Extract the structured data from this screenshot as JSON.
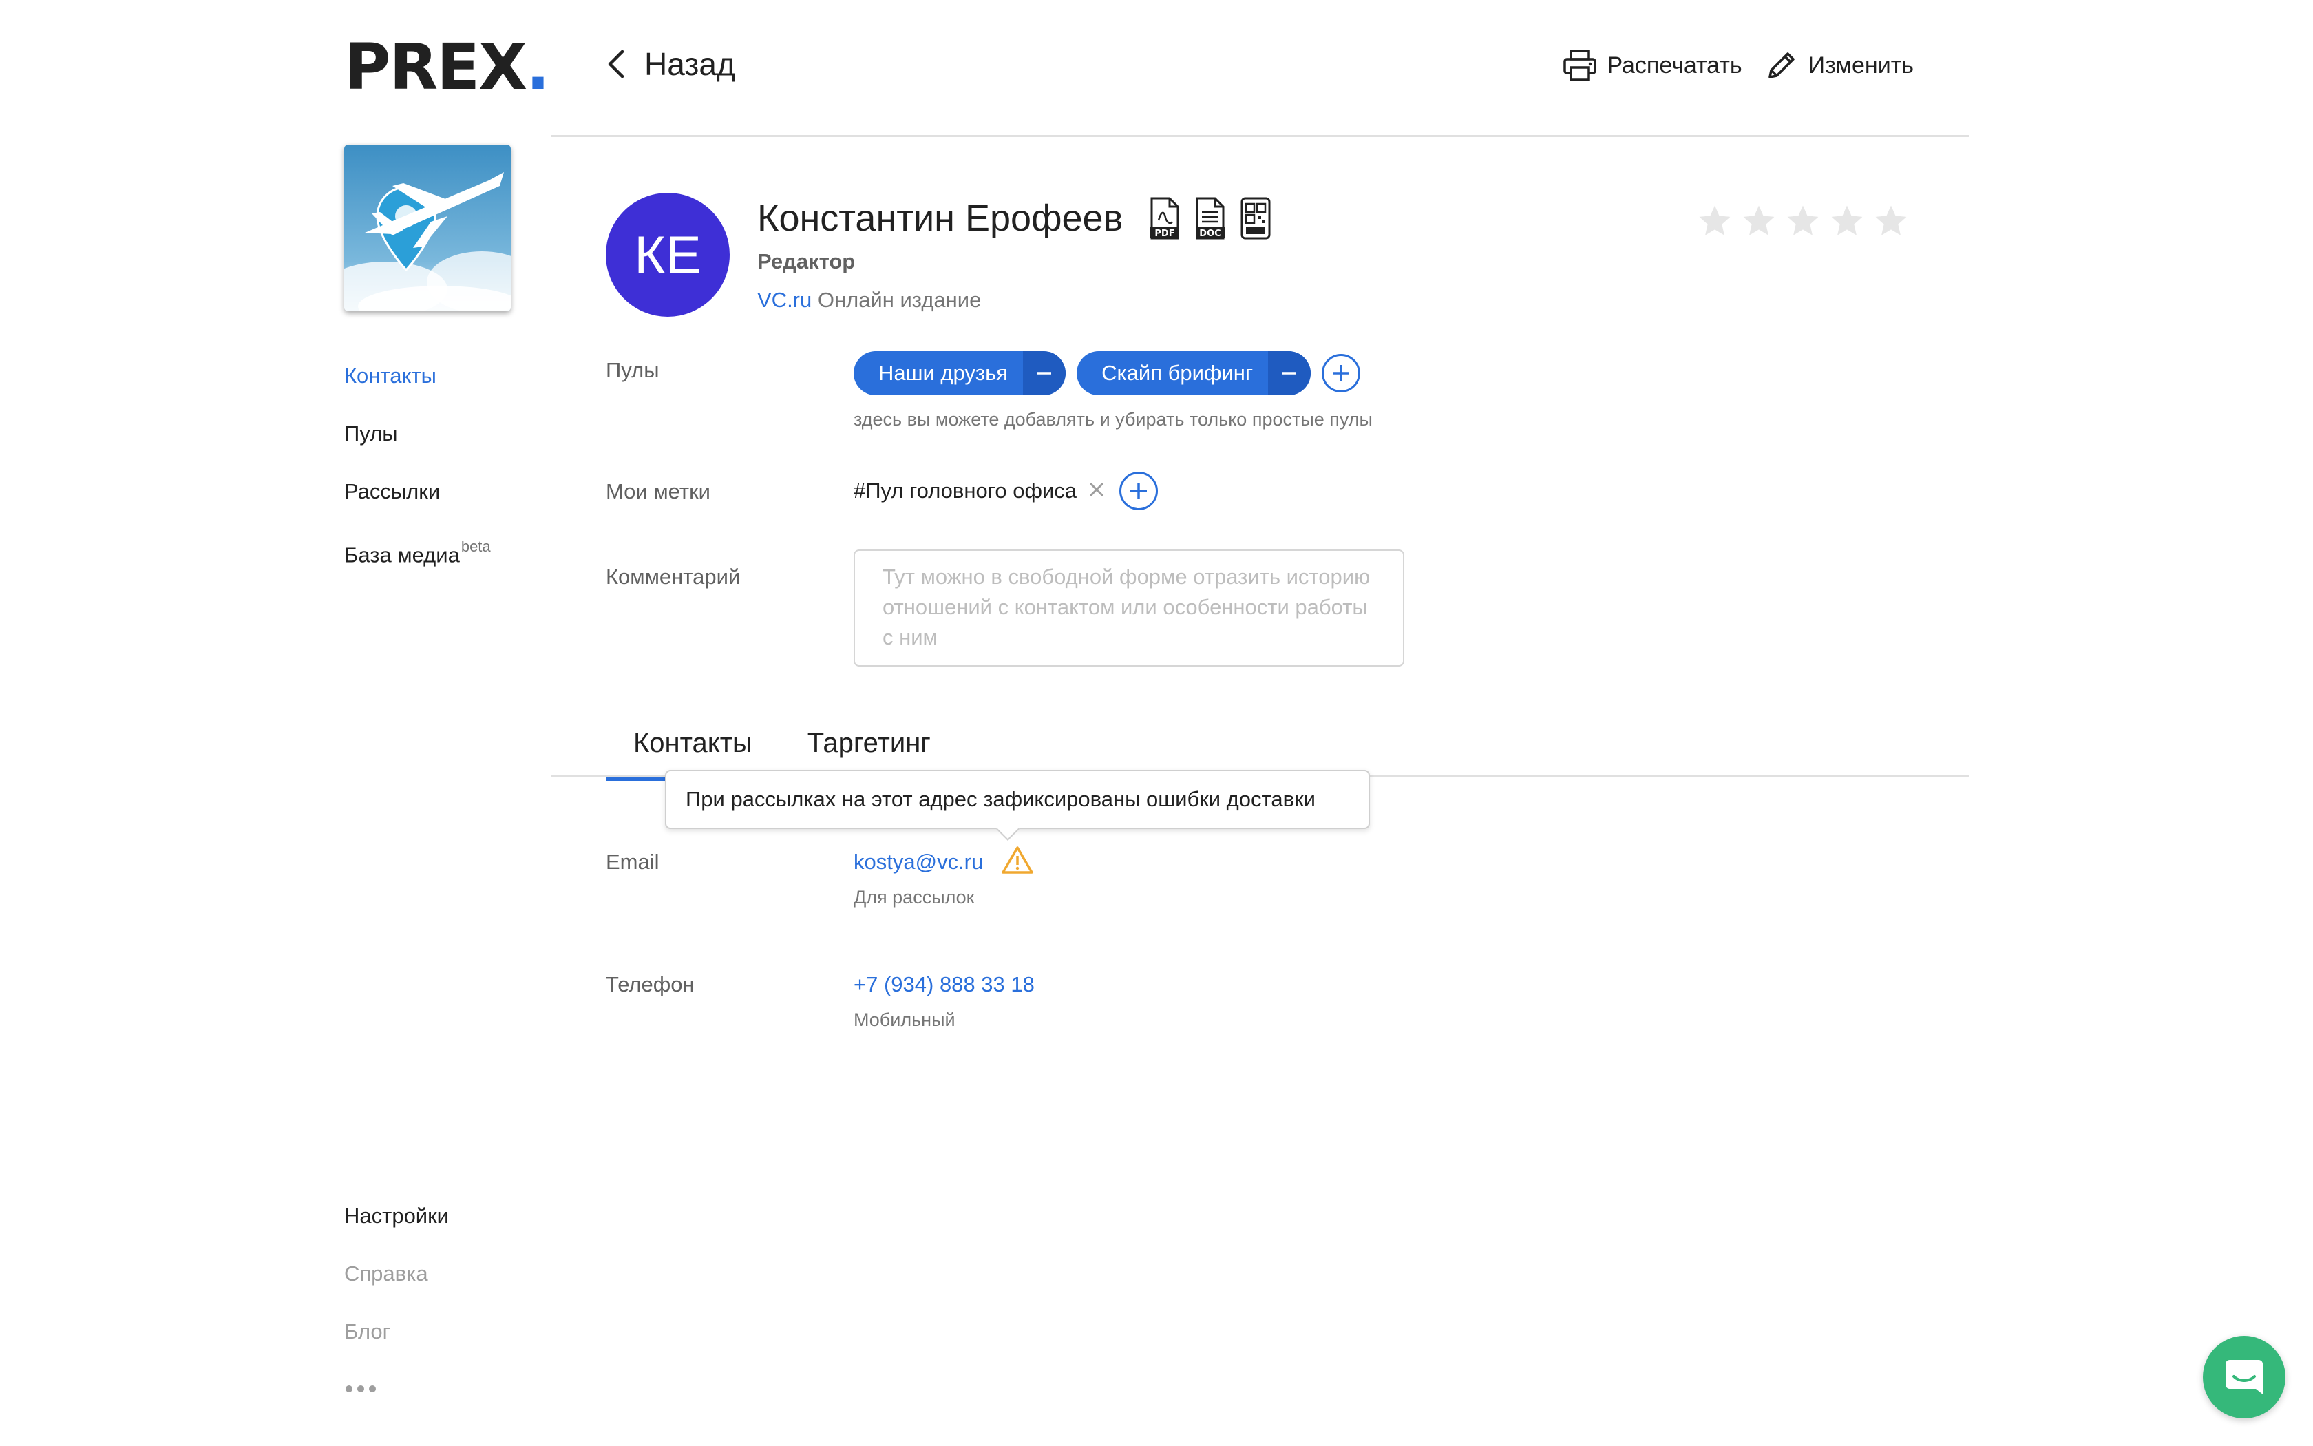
{
  "brand": {
    "name": "PREX",
    "dot": ".",
    "accent": "#2a6fdb"
  },
  "sidebar": {
    "items": [
      {
        "label": "Контакты"
      },
      {
        "label": "Пулы"
      },
      {
        "label": "Рассылки"
      },
      {
        "label": "База медиа",
        "badge": "beta"
      }
    ],
    "bottom_items": [
      {
        "label": "Настройки"
      },
      {
        "label": "Справка"
      },
      {
        "label": "Блог"
      }
    ]
  },
  "header": {
    "back_label": "Назад",
    "print_label": "Распечатать",
    "edit_label": "Изменить"
  },
  "contact": {
    "initials": "КЕ",
    "name": "Константин Ерофеев",
    "role": "Редактор",
    "outlet_link": "VC.ru",
    "outlet_type": "Онлайн издание",
    "rating": 0,
    "rating_max": 5
  },
  "pools": {
    "label": "Пулы",
    "chips": [
      "Наши друзья",
      "Скайп брифинг"
    ],
    "hint": "здесь вы можете добавлять и убирать только простые пулы"
  },
  "tags": {
    "label": "Мои метки",
    "items": [
      "#Пул головного офиса"
    ]
  },
  "comment": {
    "label": "Комментарий",
    "placeholder": "Тут можно в свободной форме отразить историю отношений с контактом или особенности работы с ним"
  },
  "tabs": [
    "Контакты",
    "Таргетинг"
  ],
  "tooltip": "При рассылках на этот адрес зафиксированы ошибки доставки",
  "email": {
    "label": "Email",
    "value": "kostya@vc.ru",
    "type": "Для рассылок"
  },
  "phone": {
    "label": "Телефон",
    "value": "+7 (934) 888 33 18",
    "type": "Мобильный"
  },
  "colors": {
    "avatar": "#3e2fd6",
    "chip": "#2a6fdb",
    "warning": "#f0a830",
    "chat": "#35b87a"
  }
}
